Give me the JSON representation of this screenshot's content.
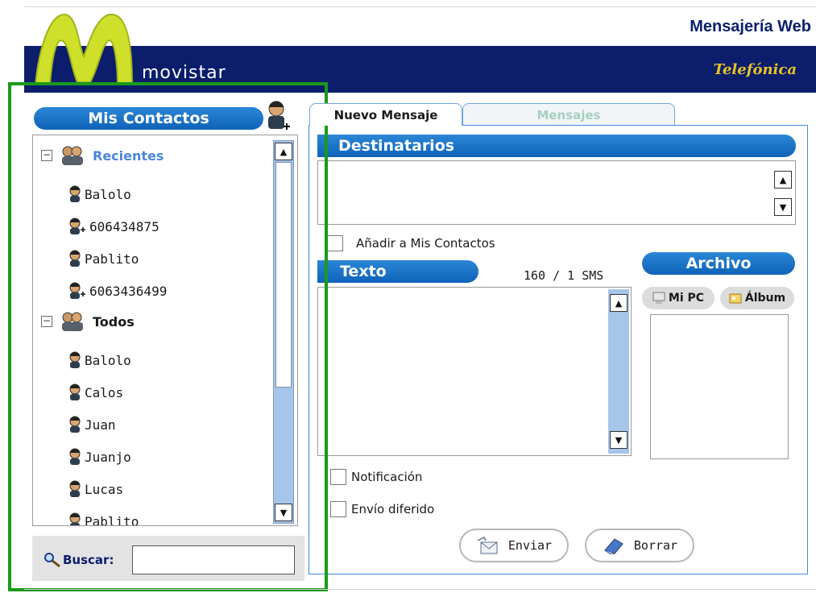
{
  "header": {
    "app_title": "Mensajería Web",
    "brand": "movistar",
    "partner": "Telefónica"
  },
  "contacts_panel": {
    "title": "Mis Contactos",
    "add_contact_icon": "add-contact-icon",
    "groups": [
      {
        "label": "Recientes",
        "expanded": true,
        "items": [
          {
            "name": "Balolo",
            "icon": "contact-icon"
          },
          {
            "name": "606434875",
            "icon": "contact-add-icon"
          },
          {
            "name": "Pablito",
            "icon": "contact-icon"
          },
          {
            "name": "6063436499",
            "icon": "contact-add-icon"
          }
        ]
      },
      {
        "label": "Todos",
        "expanded": true,
        "items": [
          {
            "name": "Balolo",
            "icon": "contact-icon"
          },
          {
            "name": "Calos",
            "icon": "contact-icon"
          },
          {
            "name": "Juan",
            "icon": "contact-icon"
          },
          {
            "name": "Juanjo",
            "icon": "contact-icon"
          },
          {
            "name": "Lucas",
            "icon": "contact-icon"
          },
          {
            "name": "Pablito",
            "icon": "contact-icon"
          }
        ]
      }
    ],
    "search": {
      "label": "Buscar:",
      "value": ""
    }
  },
  "tabs": [
    {
      "label": "Nuevo Mensaje",
      "active": true
    },
    {
      "label": "Mensajes",
      "active": false
    }
  ],
  "compose": {
    "recipients_title": "Destinatarios",
    "add_to_contacts_label": "Añadir a Mis Contactos",
    "text_title": "Texto",
    "counter": "160 / 1 SMS",
    "notification_label": "Notificación",
    "deferred_label": "Envío diferido",
    "send_label": "Enviar",
    "clear_label": "Borrar"
  },
  "attachments": {
    "title": "Archivo",
    "mi_pc_label": "Mi PC",
    "album_label": "Álbum"
  },
  "colors": {
    "navy": "#0b1d6b",
    "accent_blue": "#0f63b8",
    "highlight_green": "#1a9a1a",
    "logo_yellow": "#d9e021"
  }
}
